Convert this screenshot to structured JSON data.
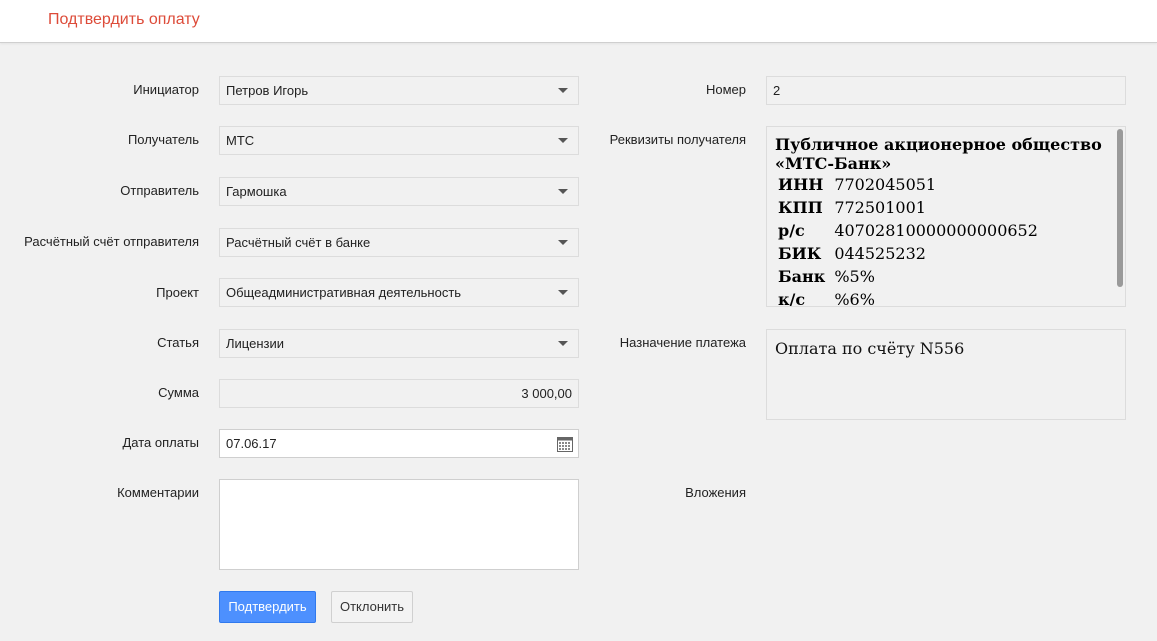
{
  "header": {
    "title": "Подтвердить оплату"
  },
  "form": {
    "initiator": {
      "label": "Инициатор",
      "value": "Петров Игорь"
    },
    "recipient": {
      "label": "Получатель",
      "value": "МТС"
    },
    "sender": {
      "label": "Отправитель",
      "value": "Гармошка"
    },
    "sender_account": {
      "label": "Расчётный счёт отправителя",
      "value": "Расчётный счёт в банке"
    },
    "project": {
      "label": "Проект",
      "value": "Общеадминистративная деятельность"
    },
    "article": {
      "label": "Статья",
      "value": "Лицензии"
    },
    "amount": {
      "label": "Сумма",
      "value": "3 000,00"
    },
    "payment_date": {
      "label": "Дата оплаты",
      "value": "07.06.17"
    },
    "comments": {
      "label": "Комментарии",
      "value": ""
    },
    "number": {
      "label": "Номер",
      "value": "2"
    },
    "recipient_details": {
      "label": "Реквизиты получателя",
      "title": "Публичное акционерное общество «МТС-Банк»",
      "rows": [
        {
          "key": "ИНН",
          "value": "7702045051"
        },
        {
          "key": "КПП",
          "value": "772501001"
        },
        {
          "key": "р/с",
          "value": "40702810000000000652"
        },
        {
          "key": "БИК",
          "value": "044525232"
        },
        {
          "key": "Банк",
          "value": "%5%"
        },
        {
          "key": "к/с",
          "value": "%6%"
        }
      ]
    },
    "payment_purpose": {
      "label": "Назначение платежа",
      "value": "Оплата по счёту N556"
    },
    "attachments": {
      "label": "Вложения"
    }
  },
  "buttons": {
    "confirm": "Подтвердить",
    "reject": "Отклонить"
  },
  "colors": {
    "accent": "#dd4b39",
    "primary_button": "#4d90fe"
  }
}
